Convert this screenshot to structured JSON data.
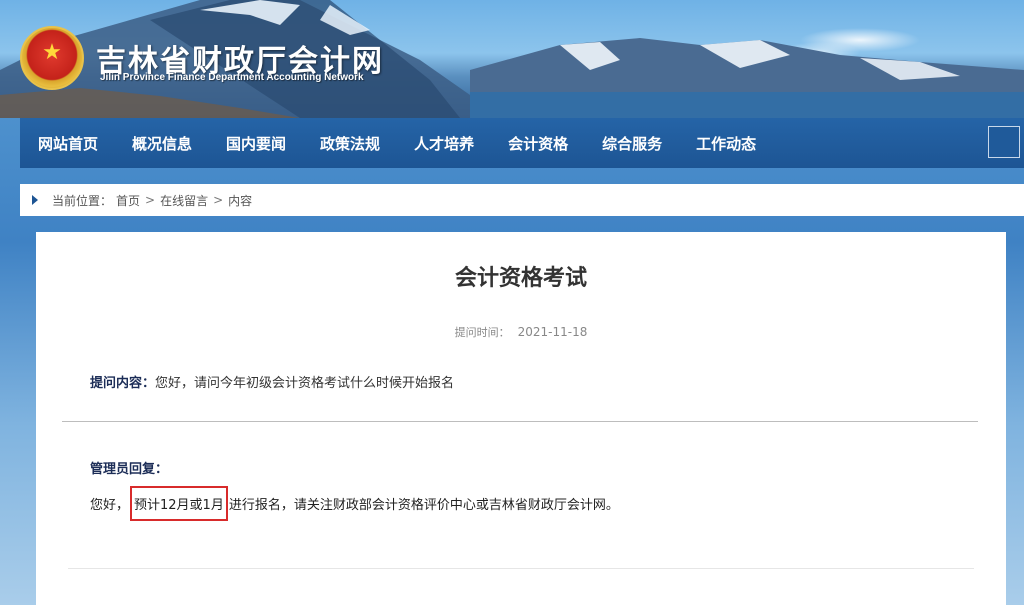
{
  "header": {
    "site_title": "吉林省财政厅会计网",
    "site_subtitle": "Jilin Province Finance Department Accounting Network",
    "emblem_icon": "national-emblem-icon"
  },
  "nav": {
    "items": [
      {
        "label": "网站首页"
      },
      {
        "label": "概况信息"
      },
      {
        "label": "国内要闻"
      },
      {
        "label": "政策法规"
      },
      {
        "label": "人才培养"
      },
      {
        "label": "会计资格"
      },
      {
        "label": "综合服务"
      },
      {
        "label": "工作动态"
      }
    ],
    "search_icon": "search-icon"
  },
  "breadcrumb": {
    "prefix": "当前位置：",
    "items": [
      {
        "label": "首页"
      },
      {
        "label": "在线留言"
      },
      {
        "label": "内容"
      }
    ],
    "separator": ">"
  },
  "article": {
    "title": "会计资格考试",
    "meta_label": "提问时间：",
    "meta_date": "2021-11-18",
    "question_label": "提问内容：",
    "question_text": "您好，请问今年初级会计资格考试什么时候开始报名",
    "reply_label": "管理员回复：",
    "reply_prefix": "您好，",
    "reply_highlight": "预计12月或1月",
    "reply_suffix": "进行报名，请关注财政部会计资格评价中心或吉林省财政厅会计网。"
  },
  "colors": {
    "nav_bg": "#1d5594",
    "highlight_box": "#d82b2b",
    "label_text": "#1c2d57"
  }
}
